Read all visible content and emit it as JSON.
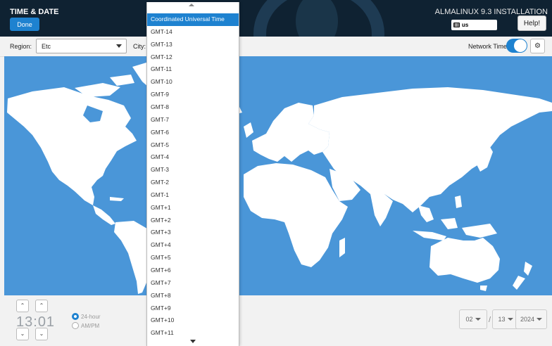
{
  "header": {
    "title": "TIME & DATE",
    "done_label": "Done",
    "installer_title": "ALMALINUX 9.3 INSTALLATION",
    "keyboard_layout": "us",
    "help_label": "Help!"
  },
  "toolbar": {
    "region_label": "Region:",
    "region_value": "Etc",
    "city_label": "City:",
    "network_time_label": "Network Time",
    "network_time_on": true
  },
  "city_dropdown": {
    "items": [
      "Coordinated Universal Time",
      "GMT-14",
      "GMT-13",
      "GMT-12",
      "GMT-11",
      "GMT-10",
      "GMT-9",
      "GMT-8",
      "GMT-7",
      "GMT-6",
      "GMT-5",
      "GMT-4",
      "GMT-3",
      "GMT-2",
      "GMT-1",
      "GMT+1",
      "GMT+2",
      "GMT+3",
      "GMT+4",
      "GMT+5",
      "GMT+6",
      "GMT+7",
      "GMT+8",
      "GMT+9",
      "GMT+10",
      "GMT+11"
    ],
    "selected": "Coordinated Universal Time"
  },
  "time": {
    "hours": "13",
    "separator": ":",
    "minutes": "01",
    "format_24h_label": "24-hour",
    "format_ampm_label": "AM/PM",
    "selected_format": "24-hour"
  },
  "date": {
    "month": "02",
    "day": "13",
    "year": "2024",
    "separator": "/"
  },
  "colors": {
    "accent": "#1e82d0",
    "header_bg": "#0f2232",
    "ocean": "#4a96d8",
    "land": "#ffffff"
  },
  "icons": {
    "keyboard": "keyboard-icon",
    "network_settings": "gear-icon",
    "spin_up": "chevron-up-icon",
    "spin_down": "chevron-down-icon"
  }
}
